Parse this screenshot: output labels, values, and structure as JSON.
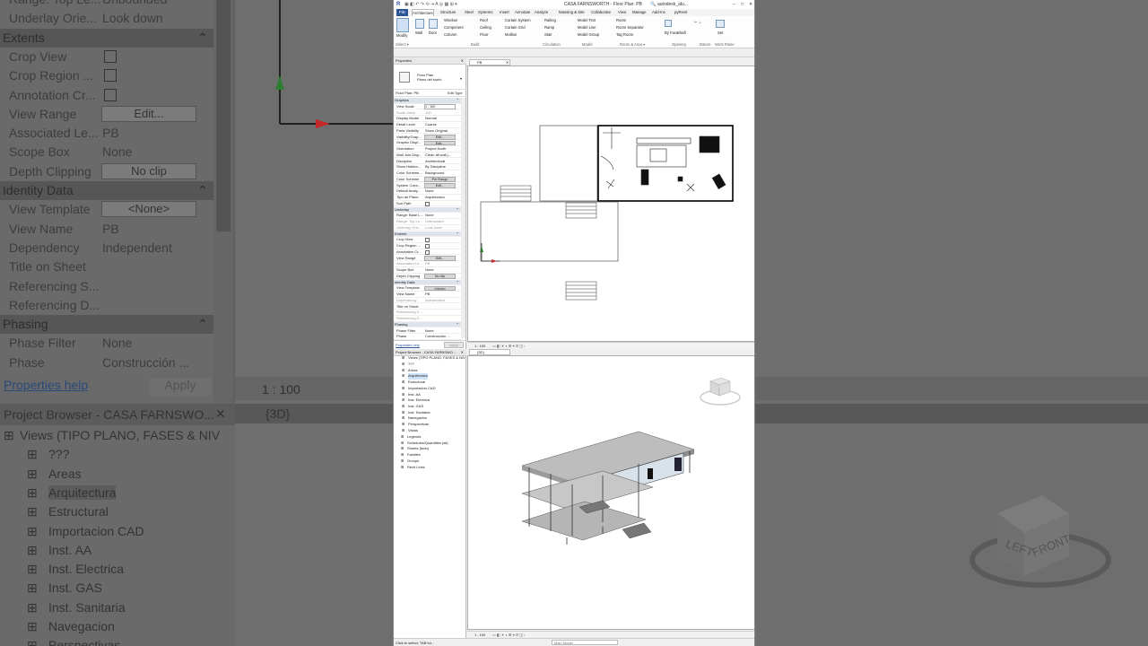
{
  "window": {
    "title": "CASA FARNSWORTH - Floor Plan: PB",
    "search": "autodesk_alu..."
  },
  "ribbon": {
    "file_tab": "File",
    "tabs": [
      "Architecture",
      "Structure",
      "Steel",
      "Systems",
      "Insert",
      "Annotate",
      "Analyze",
      "Massing & Site",
      "Collaborate",
      "View",
      "Manage",
      "Add-Ins",
      "pyRevit"
    ],
    "modify": "Modify",
    "select": "Select ▾",
    "build_items": [
      "Wall",
      "Door",
      "Window",
      "Component",
      "Column",
      "Roof",
      "Ceiling",
      "Floor",
      "Curtain System",
      "Curtain Grid",
      "Mullion"
    ],
    "circulation_items": [
      "Railing",
      "Ramp",
      "Stair"
    ],
    "model_items": [
      "Model Text",
      "Model Line",
      "Model Group"
    ],
    "room_items": [
      "Room",
      "Room Separator",
      "Tag Room"
    ],
    "opening_items": [
      "By Face",
      "Shaft"
    ],
    "datum_items": [
      "Set"
    ],
    "groups": [
      "Build",
      "Circulation",
      "Model",
      "Room & Area ▾",
      "Opening",
      "Datum",
      "Work Plane"
    ]
  },
  "properties": {
    "header": "Properties",
    "type_name": "Floor Plan",
    "type_sub": "Plano del suelo",
    "filter": "Floor Plan: PB",
    "edit_type": "Edit Type",
    "rows": [
      {
        "k": "Graphics",
        "v": "",
        "sec": true
      },
      {
        "k": "View Scale",
        "v": "1 : 100",
        "box": true
      },
      {
        "k": "Scale Value",
        "v": "100",
        "dim": true
      },
      {
        "k": "Display Model",
        "v": "Normal"
      },
      {
        "k": "Detail Level",
        "v": "Coarse"
      },
      {
        "k": "Parts Visibility",
        "v": "Show Original"
      },
      {
        "k": "Visibility/Grap...",
        "v": "Edit...",
        "btn": true
      },
      {
        "k": "Graphic Displ...",
        "v": "Edit...",
        "btn": true
      },
      {
        "k": "Orientation",
        "v": "Project North"
      },
      {
        "k": "Wall Join Disp...",
        "v": "Clean all wall j..."
      },
      {
        "k": "Discipline",
        "v": "Architectural"
      },
      {
        "k": "Show Hidden...",
        "v": "By Discipline"
      },
      {
        "k": "Color Scheme...",
        "v": "Background"
      },
      {
        "k": "Color Scheme",
        "v": "Por Rango",
        "btn": true
      },
      {
        "k": "System Color...",
        "v": "Edit...",
        "btn": true
      },
      {
        "k": "Default Analy...",
        "v": "None"
      },
      {
        "k": "Tipo de Plano",
        "v": "Arquitectura"
      },
      {
        "k": "Sun Path",
        "v": "",
        "cb": true
      },
      {
        "k": "Underlay",
        "v": "",
        "sec": true
      },
      {
        "k": "Range: Base L...",
        "v": "None"
      },
      {
        "k": "Range: Top Le...",
        "v": "Unbounded",
        "dim": true
      },
      {
        "k": "Underlay Orie...",
        "v": "Look down",
        "dim": true
      },
      {
        "k": "Extents",
        "v": "",
        "sec": true
      },
      {
        "k": "Crop View",
        "v": "",
        "cb": true
      },
      {
        "k": "Crop Region ...",
        "v": "",
        "cb": true
      },
      {
        "k": "Annotation Cr...",
        "v": "",
        "cb": true
      },
      {
        "k": "View Range",
        "v": "Edit...",
        "btn": true
      },
      {
        "k": "Associated Le...",
        "v": "PB",
        "dim": true
      },
      {
        "k": "Scope Box",
        "v": "None"
      },
      {
        "k": "Depth Clipping",
        "v": "No clip",
        "btn": true
      },
      {
        "k": "Identity Data",
        "v": "",
        "sec": true
      },
      {
        "k": "View Template",
        "v": "<None>",
        "btn": true
      },
      {
        "k": "View Name",
        "v": "PB"
      },
      {
        "k": "Dependency",
        "v": "Independent",
        "dim": true
      },
      {
        "k": "Title on Sheet",
        "v": ""
      },
      {
        "k": "Referencing S...",
        "v": "",
        "dim": true
      },
      {
        "k": "Referencing D...",
        "v": "",
        "dim": true
      },
      {
        "k": "Phasing",
        "v": "",
        "sec": true
      },
      {
        "k": "Phase Filter",
        "v": "None"
      },
      {
        "k": "Phase",
        "v": "Construcción ..."
      }
    ],
    "help": "Properties help",
    "apply": "Apply"
  },
  "browser": {
    "header": "Project Browser - CASA FARNSWO...",
    "root": "Views (TIPO PLANO, FASES & NIV",
    "items": [
      "???",
      "Areas",
      "Arquitectura",
      "Estructural",
      "Importacion CAD",
      "Inst. AA",
      "Inst. Electrica",
      "Inst. GAS",
      "Inst. Sanitaria",
      "Navegacion",
      "Perspectivas",
      "Vistas"
    ],
    "top": [
      "Legends",
      "Schedules/Quantities (all)",
      "Sheets (todo)",
      "Families",
      "Groups",
      "Revit Links"
    ]
  },
  "views": {
    "plan_tab": "PB",
    "view3d_tab": "{3D}",
    "scale": "1 : 100"
  },
  "status": {
    "hint": "Click to select, TAB for...",
    "model": "Main Model"
  },
  "bg": {
    "rows": [
      {
        "k": "Range: Top Le...",
        "v": "Unbounded"
      },
      {
        "k": "Underlay Orie...",
        "v": "Look down"
      },
      {
        "k": "Extents",
        "v": "",
        "sec": true
      },
      {
        "k": "Crop View",
        "v": "",
        "cb": true
      },
      {
        "k": "Crop Region ...",
        "v": "",
        "cb": true
      },
      {
        "k": "Annotation Cr...",
        "v": "",
        "cb": true
      },
      {
        "k": "View Range",
        "v": "Edit...",
        "btn": true
      },
      {
        "k": "Associated Le...",
        "v": "PB"
      },
      {
        "k": "Scope Box",
        "v": "None"
      },
      {
        "k": "Depth Clipping",
        "v": "No clip",
        "btn": true
      },
      {
        "k": "Identity Data",
        "v": "",
        "sec": true
      },
      {
        "k": "View Template",
        "v": "<None>",
        "btn": true
      },
      {
        "k": "View Name",
        "v": "PB"
      },
      {
        "k": "Dependency",
        "v": "Independent"
      },
      {
        "k": "Title on Sheet",
        "v": ""
      },
      {
        "k": "Referencing S...",
        "v": ""
      },
      {
        "k": "Referencing D...",
        "v": ""
      },
      {
        "k": "Phasing",
        "v": "",
        "sec": true
      },
      {
        "k": "Phase Filter",
        "v": "None"
      },
      {
        "k": "Phase",
        "v": "Construcción ..."
      }
    ],
    "help": "Properties help",
    "apply": "Apply",
    "scale": "1 : 100",
    "pb_header": "Project Browser - CASA FARNSWO...",
    "tab3d": "{3D}",
    "pb_items": [
      "Views (TIPO PLANO, FASES & NIV",
      "???",
      "Areas",
      "Arquitectura",
      "Estructural",
      "Importacion CAD",
      "Inst. AA",
      "Inst. Electrica",
      "Inst. GAS",
      "Inst. Sanitaria",
      "Navegacion",
      "Perspectivas"
    ],
    "cube_left": "LEFT",
    "cube_front": "FRONT"
  }
}
